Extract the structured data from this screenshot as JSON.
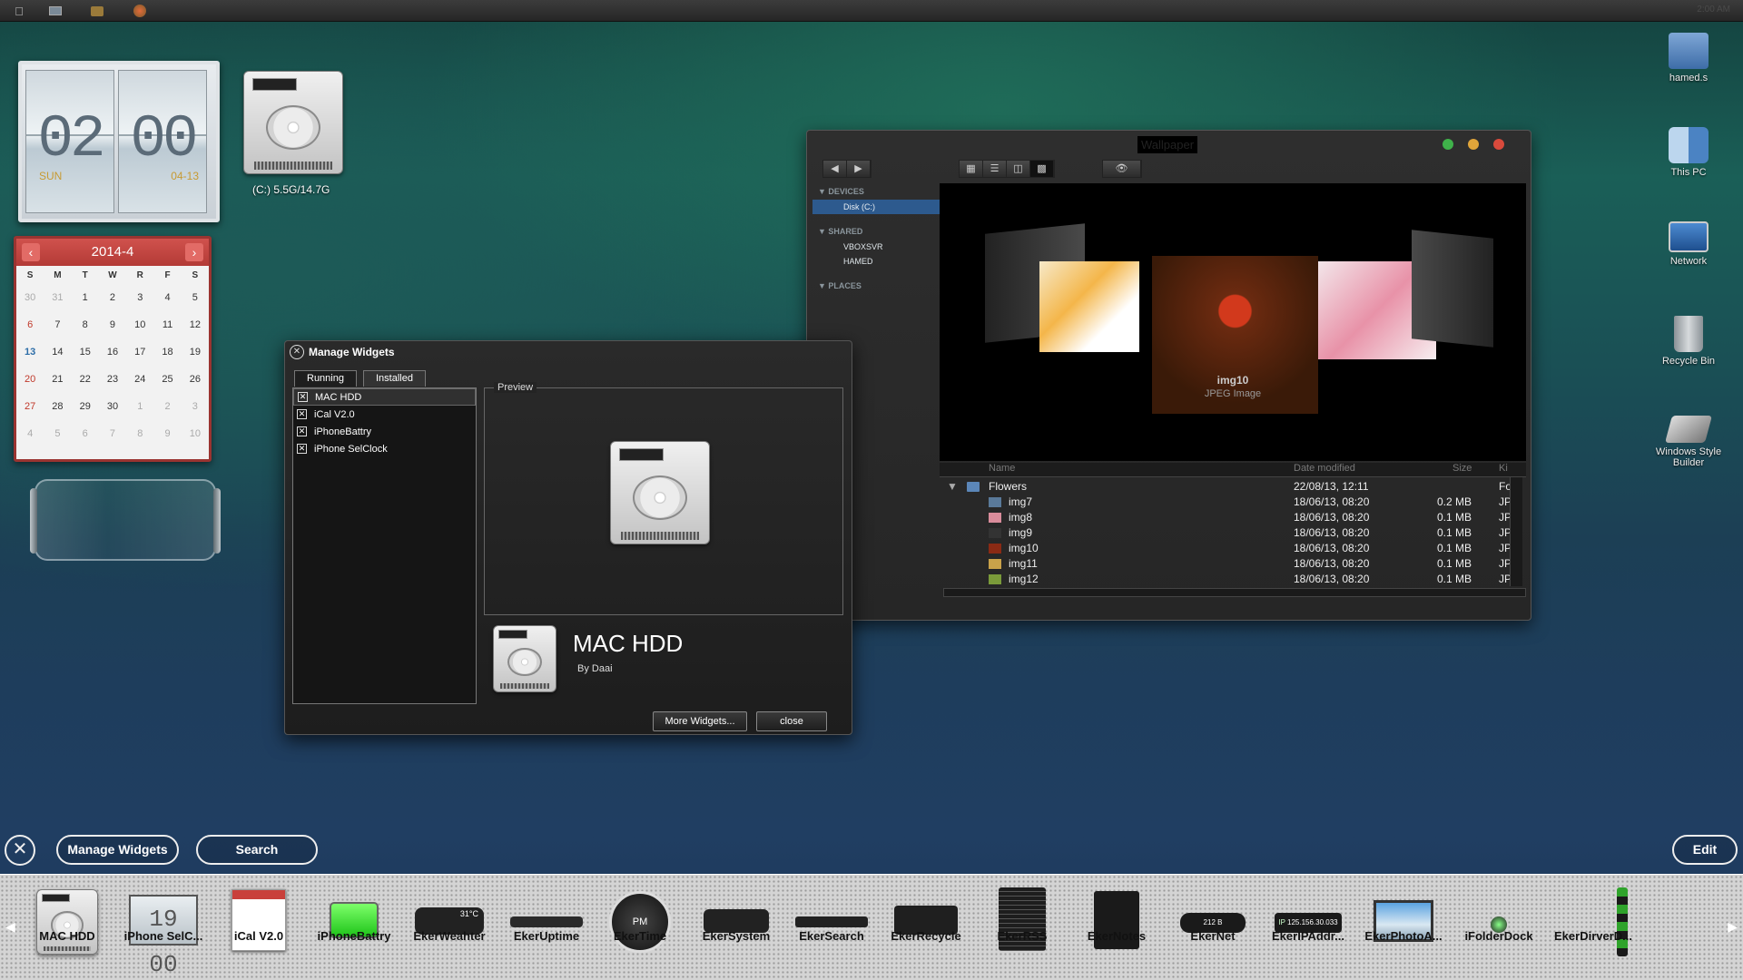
{
  "menubar": {
    "icons": [
      "apple-icon",
      "monitor-icon",
      "folder-icon",
      "compass-icon"
    ],
    "clock": "2:00 AM"
  },
  "flip_clock": {
    "hours": "02",
    "minutes": "00",
    "day": "SUN",
    "date": "04-13"
  },
  "calendar": {
    "title": "2014-4",
    "prev": "‹",
    "next": "›",
    "dow": [
      "S",
      "M",
      "T",
      "W",
      "R",
      "F",
      "S"
    ],
    "weeks": [
      [
        "30",
        "31",
        "1",
        "2",
        "3",
        "4",
        "5"
      ],
      [
        "6",
        "7",
        "8",
        "9",
        "10",
        "11",
        "12"
      ],
      [
        "13",
        "14",
        "15",
        "16",
        "17",
        "18",
        "19"
      ],
      [
        "20",
        "21",
        "22",
        "23",
        "24",
        "25",
        "26"
      ],
      [
        "27",
        "28",
        "29",
        "30",
        "1",
        "2",
        "3"
      ],
      [
        "4",
        "5",
        "6",
        "7",
        "8",
        "9",
        "10"
      ]
    ]
  },
  "hdd_widget": {
    "label": "(C:)  5.5G/14.7G"
  },
  "desktop_icons": [
    {
      "label": "hamed.s",
      "icon": "user-folder-icon"
    },
    {
      "label": "This PC",
      "icon": "finder-icon"
    },
    {
      "label": "Network",
      "icon": "monitor-icon"
    },
    {
      "label": "Recycle Bin",
      "icon": "trash-icon"
    },
    {
      "label": "Windows Style Builder",
      "icon": "builder-icon"
    }
  ],
  "manage_widgets": {
    "title": "Manage Widgets",
    "close_glyph": "✕",
    "tabs": [
      "Running",
      "Installed"
    ],
    "items": [
      "MAC HDD",
      "iCal V2.0",
      "iPhoneBattry",
      "iPhone SelClock"
    ],
    "check_glyph": "✕",
    "preview_label": "Preview",
    "selected_name": "MAC HDD",
    "selected_author": "By Daai",
    "more_button": "More Widgets...",
    "close_button": "close"
  },
  "finder": {
    "title": "Wallpaper",
    "sidebar": {
      "devices_header": "DEVICES",
      "devices": [
        "Disk (C:)"
      ],
      "shared_header": "SHARED",
      "shared": [
        "VBOXSVR",
        "HAMED"
      ],
      "places_header": "PLACES"
    },
    "coverflow": {
      "name": "img10",
      "kind": "JPEG Image"
    },
    "columns": {
      "name": "Name",
      "date": "Date modified",
      "size": "Size",
      "kind": "Ki"
    },
    "folder": {
      "name": "Flowers",
      "date": "22/08/13, 12:11",
      "kind": "Fo"
    },
    "files": [
      {
        "name": "img7",
        "date": "18/06/13, 08:20",
        "size": "0.2 MB",
        "kind": "JPI"
      },
      {
        "name": "img8",
        "date": "18/06/13, 08:20",
        "size": "0.1 MB",
        "kind": "JPI"
      },
      {
        "name": "img9",
        "date": "18/06/13, 08:20",
        "size": "0.1 MB",
        "kind": "JPI"
      },
      {
        "name": "img10",
        "date": "18/06/13, 08:20",
        "size": "0.1 MB",
        "kind": "JPI"
      },
      {
        "name": "img11",
        "date": "18/06/13, 08:20",
        "size": "0.1 MB",
        "kind": "JPI"
      },
      {
        "name": "img12",
        "date": "18/06/13, 08:20",
        "size": "0.1 MB",
        "kind": "JPI"
      }
    ]
  },
  "bottom_bar": {
    "close_glyph": "✕",
    "manage": "Manage Widgets",
    "search": "Search",
    "edit": "Edit"
  },
  "dock": {
    "items": [
      "MAC HDD",
      "iPhone SelC...",
      "iCal V2.0",
      "iPhoneBattry",
      "EkerWeahter",
      "EkerUptime",
      "EkerTime",
      "EkerSystem",
      "EkerSearch",
      "EkerRecycle",
      "EkerRSS",
      "EkerNotes",
      "EkerNet",
      "EkerIPAddr...",
      "EkerPhotoA...",
      "iFolderDock",
      "EkerDirverD..."
    ],
    "clock_value": "19 00",
    "weather_temp": "31°C",
    "time_label": "PM",
    "net_value": "212 B",
    "ip_label": "IP",
    "ip_value": "125.156.30.033"
  }
}
